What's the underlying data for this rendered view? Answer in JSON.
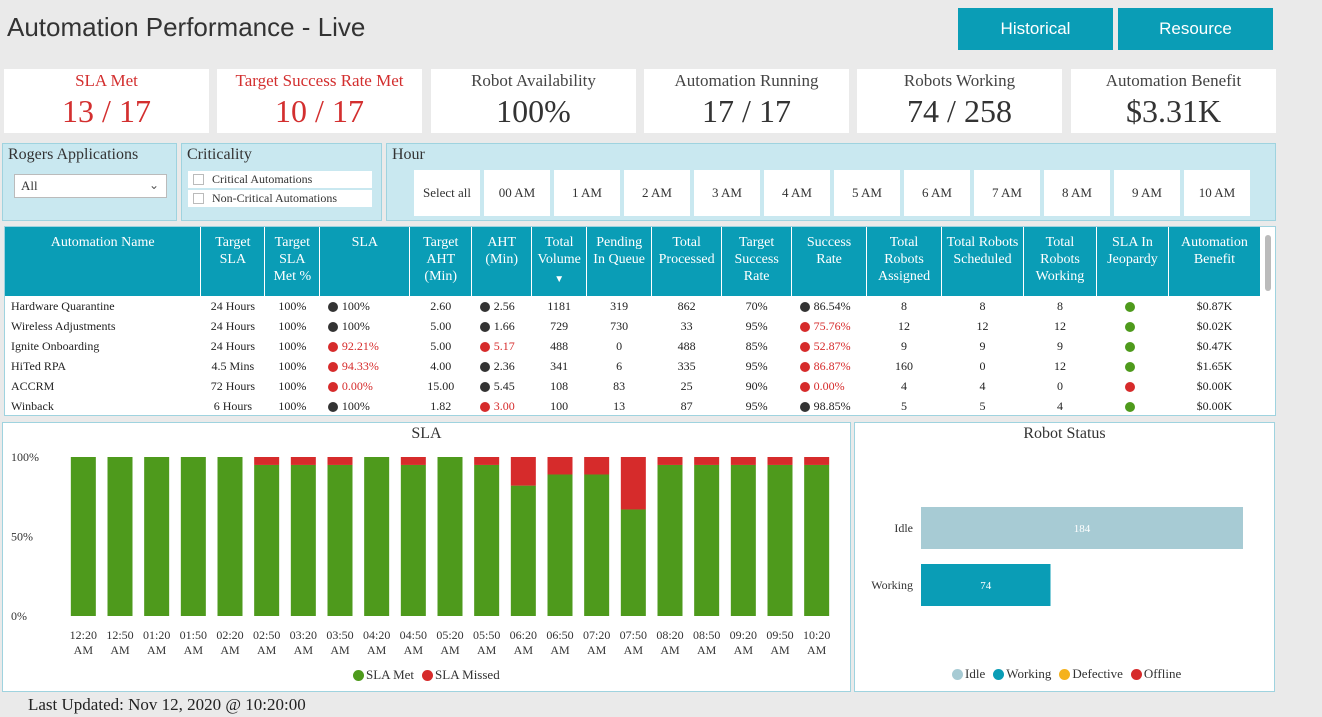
{
  "header": {
    "title": "Automation Performance - Live",
    "buttons": {
      "historical": "Historical",
      "resource": "Resource"
    }
  },
  "colors": {
    "accent": "#0a9db6",
    "met": "#4e9a1c",
    "missed": "#d62b2b",
    "idle": "#a7cbd4",
    "working": "#0a9db6",
    "defective": "#f5b21c",
    "offline": "#d62b2b"
  },
  "kpis": [
    {
      "label": "SLA Met",
      "value": "13 / 17",
      "status": "red"
    },
    {
      "label": "Target Success Rate Met",
      "value": "10 / 17",
      "status": "red"
    },
    {
      "label": "Robot Availability",
      "value": "100%",
      "status": "normal"
    },
    {
      "label": "Automation Running",
      "value": "17 / 17",
      "status": "normal"
    },
    {
      "label": "Robots Working",
      "value": "74 / 258",
      "status": "normal"
    },
    {
      "label": "Automation Benefit",
      "value": "$3.31K",
      "status": "normal"
    }
  ],
  "filters": {
    "applications": {
      "title": "Rogers Applications",
      "selected": "All"
    },
    "criticality": {
      "title": "Criticality",
      "options": [
        "Critical Automations",
        "Non-Critical Automations"
      ]
    },
    "hour": {
      "title": "Hour",
      "options": [
        "Select all",
        "00 AM",
        "1 AM",
        "2 AM",
        "3 AM",
        "4 AM",
        "5 AM",
        "6 AM",
        "7 AM",
        "8 AM",
        "9 AM",
        "10 AM"
      ]
    }
  },
  "table": {
    "columns": [
      "Automation Name",
      "Target SLA",
      "Target SLA Met %",
      "SLA",
      "Target AHT (Min)",
      "AHT (Min)",
      "Total Volume",
      "Pending In Queue",
      "Total Processed",
      "Target Success Rate",
      "Success Rate",
      "Total Robots Assigned",
      "Total Robots Scheduled",
      "Total Robots Working",
      "SLA In Jeopardy",
      "Automation Benefit"
    ],
    "rows": [
      {
        "name": "Hardware Quarantine",
        "target_sla": "24 Hours",
        "target_sla_met": "100%",
        "sla": "100%",
        "sla_status": "dark",
        "target_aht": "2.60",
        "aht": "2.56",
        "aht_status": "dark",
        "volume": "1181",
        "pending": "319",
        "processed": "862",
        "target_success": "70%",
        "success": "86.54%",
        "success_status": "dark",
        "assigned": "8",
        "scheduled": "8",
        "working": "8",
        "jeopardy": "green",
        "benefit": "$0.87K"
      },
      {
        "name": "Wireless Adjustments",
        "target_sla": "24 Hours",
        "target_sla_met": "100%",
        "sla": "100%",
        "sla_status": "dark",
        "target_aht": "5.00",
        "aht": "1.66",
        "aht_status": "dark",
        "volume": "729",
        "pending": "730",
        "processed": "33",
        "target_success": "95%",
        "success": "75.76%",
        "success_status": "red",
        "assigned": "12",
        "scheduled": "12",
        "working": "12",
        "jeopardy": "green",
        "benefit": "$0.02K"
      },
      {
        "name": "Ignite Onboarding",
        "target_sla": "24 Hours",
        "target_sla_met": "100%",
        "sla": "92.21%",
        "sla_status": "red",
        "target_aht": "5.00",
        "aht": "5.17",
        "aht_status": "red",
        "volume": "488",
        "pending": "0",
        "processed": "488",
        "target_success": "85%",
        "success": "52.87%",
        "success_status": "red",
        "assigned": "9",
        "scheduled": "9",
        "working": "9",
        "jeopardy": "green",
        "benefit": "$0.47K"
      },
      {
        "name": "HiTed RPA",
        "target_sla": "4.5 Mins",
        "target_sla_met": "100%",
        "sla": "94.33%",
        "sla_status": "red",
        "target_aht": "4.00",
        "aht": "2.36",
        "aht_status": "dark",
        "volume": "341",
        "pending": "6",
        "processed": "335",
        "target_success": "95%",
        "success": "86.87%",
        "success_status": "red",
        "assigned": "160",
        "scheduled": "0",
        "working": "12",
        "jeopardy": "green",
        "benefit": "$1.65K"
      },
      {
        "name": "ACCRM",
        "target_sla": "72 Hours",
        "target_sla_met": "100%",
        "sla": "0.00%",
        "sla_status": "red",
        "target_aht": "15.00",
        "aht": "5.45",
        "aht_status": "dark",
        "volume": "108",
        "pending": "83",
        "processed": "25",
        "target_success": "90%",
        "success": "0.00%",
        "success_status": "red",
        "assigned": "4",
        "scheduled": "4",
        "working": "0",
        "jeopardy": "red",
        "benefit": "$0.00K"
      },
      {
        "name": "Winback",
        "target_sla": "6 Hours",
        "target_sla_met": "100%",
        "sla": "100%",
        "sla_status": "dark",
        "target_aht": "1.82",
        "aht": "3.00",
        "aht_status": "red",
        "volume": "100",
        "pending": "13",
        "processed": "87",
        "target_success": "95%",
        "success": "98.85%",
        "success_status": "dark",
        "assigned": "5",
        "scheduled": "5",
        "working": "4",
        "jeopardy": "green",
        "benefit": "$0.00K"
      }
    ]
  },
  "chart_data": [
    {
      "type": "bar",
      "stacked": true,
      "title": "SLA",
      "categories": [
        "12:20 AM",
        "12:50 AM",
        "01:20 AM",
        "01:50 AM",
        "02:20 AM",
        "02:50 AM",
        "03:20 AM",
        "03:50 AM",
        "04:20 AM",
        "04:50 AM",
        "05:20 AM",
        "05:50 AM",
        "06:20 AM",
        "06:50 AM",
        "07:20 AM",
        "07:50 AM",
        "08:20 AM",
        "08:50 AM",
        "09:20 AM",
        "09:50 AM",
        "10:20 AM"
      ],
      "series": [
        {
          "name": "SLA Met",
          "values": [
            100,
            100,
            100,
            100,
            100,
            95,
            95,
            95,
            100,
            95,
            100,
            95,
            82,
            89,
            89,
            67,
            95,
            95,
            95,
            95,
            95
          ]
        },
        {
          "name": "SLA Missed",
          "values": [
            0,
            0,
            0,
            0,
            0,
            5,
            5,
            5,
            0,
            5,
            0,
            5,
            18,
            11,
            11,
            33,
            5,
            5,
            5,
            5,
            5
          ]
        }
      ],
      "yticks": [
        "100%",
        "50%",
        "0%"
      ],
      "ylim": [
        0,
        100
      ],
      "legend_position": "bottom"
    },
    {
      "type": "bar",
      "orientation": "horizontal",
      "title": "Robot Status",
      "categories": [
        "Idle",
        "Working"
      ],
      "values": [
        184,
        74
      ],
      "legend": [
        "Idle",
        "Working",
        "Defective",
        "Offline"
      ],
      "legend_position": "bottom"
    }
  ],
  "footer": {
    "last_updated": "Last Updated: Nov 12, 2020 @ 10:20:00"
  }
}
